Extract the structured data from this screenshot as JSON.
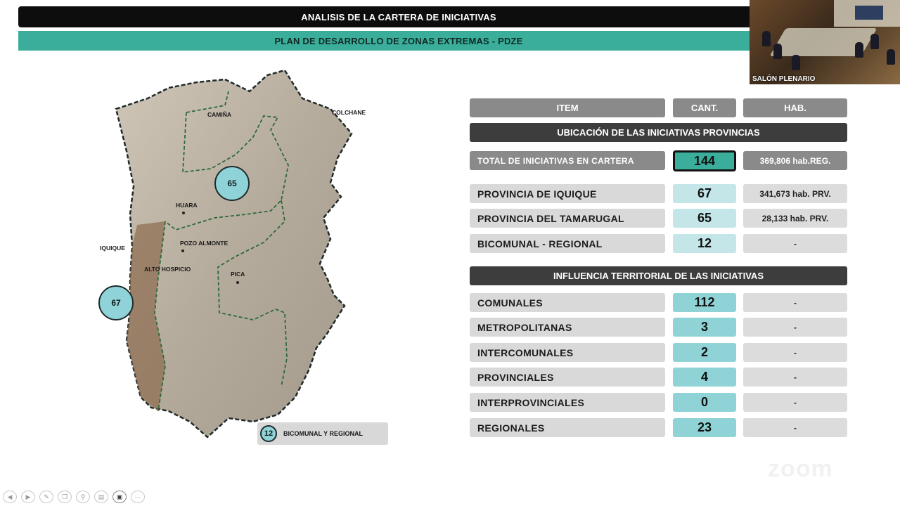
{
  "header": {
    "title": "ANALISIS DE LA CARTERA DE INICIATIVAS",
    "subtitle": "PLAN DE DESARROLLO DE ZONAS EXTREMAS - PDZE"
  },
  "video": {
    "caption": "SALÓN PLENARIO"
  },
  "map": {
    "places": {
      "camina": "CAMIÑA",
      "colchane": "COLCHANE",
      "huara": "HUARA",
      "iquique": "IQUIQUE",
      "pozo_almonte": "POZO ALMONTE",
      "alto_hospicio": "ALTO HOSPICIO",
      "pica": "PICA"
    },
    "bubbles": {
      "tamarugal": "65",
      "iquique": "67"
    },
    "legend": {
      "value": "12",
      "label": "BICOMUNAL Y REGIONAL"
    }
  },
  "table": {
    "headers": {
      "item": "ITEM",
      "cant": "CANT.",
      "hab": "HAB."
    },
    "section_ubicacion": "UBICACIÓN DE LAS INICIATIVAS PROVINCIAS",
    "total": {
      "item": "TOTAL DE INICIATIVAS EN CARTERA",
      "cant": "144",
      "hab": "369,806 hab.REG."
    },
    "ubicacion_rows": [
      {
        "item": "PROVINCIA DE IQUIQUE",
        "cant": "67",
        "hab": "341,673 hab. PRV."
      },
      {
        "item": "PROVINCIA DEL TAMARUGAL",
        "cant": "65",
        "hab": "28,133 hab. PRV."
      },
      {
        "item": "BICOMUNAL - REGIONAL",
        "cant": "12",
        "hab": "-"
      }
    ],
    "section_influencia": "INFLUENCIA TERRITORIAL DE LAS INICIATIVAS",
    "influencia_rows": [
      {
        "item": "COMUNALES",
        "cant": "112",
        "hab": "-"
      },
      {
        "item": "METROPOLITANAS",
        "cant": "3",
        "hab": "-"
      },
      {
        "item": "INTERCOMUNALES",
        "cant": "2",
        "hab": "-"
      },
      {
        "item": "PROVINCIALES",
        "cant": "4",
        "hab": "-"
      },
      {
        "item": "INTERPROVINCIALES",
        "cant": "0",
        "hab": "-"
      },
      {
        "item": "REGIONALES",
        "cant": "23",
        "hab": "-"
      }
    ]
  },
  "watermark": "zoom",
  "toolbar": {
    "icons": [
      "previous-icon",
      "next-icon",
      "pen-icon",
      "copy-icon",
      "zoom-icon",
      "subtitles-icon",
      "camera-icon",
      "more-icon"
    ],
    "glyphs": [
      "◀",
      "▶",
      "✎",
      "❐",
      "⚲",
      "▤",
      "▣",
      "⋯"
    ]
  },
  "colors": {
    "accent": "#3aae9a",
    "cant_light": "#c4e6e8",
    "cant_mid": "#8fd3d6",
    "header_dark": "#3d3d3d",
    "gray": "#8a8a8a"
  }
}
